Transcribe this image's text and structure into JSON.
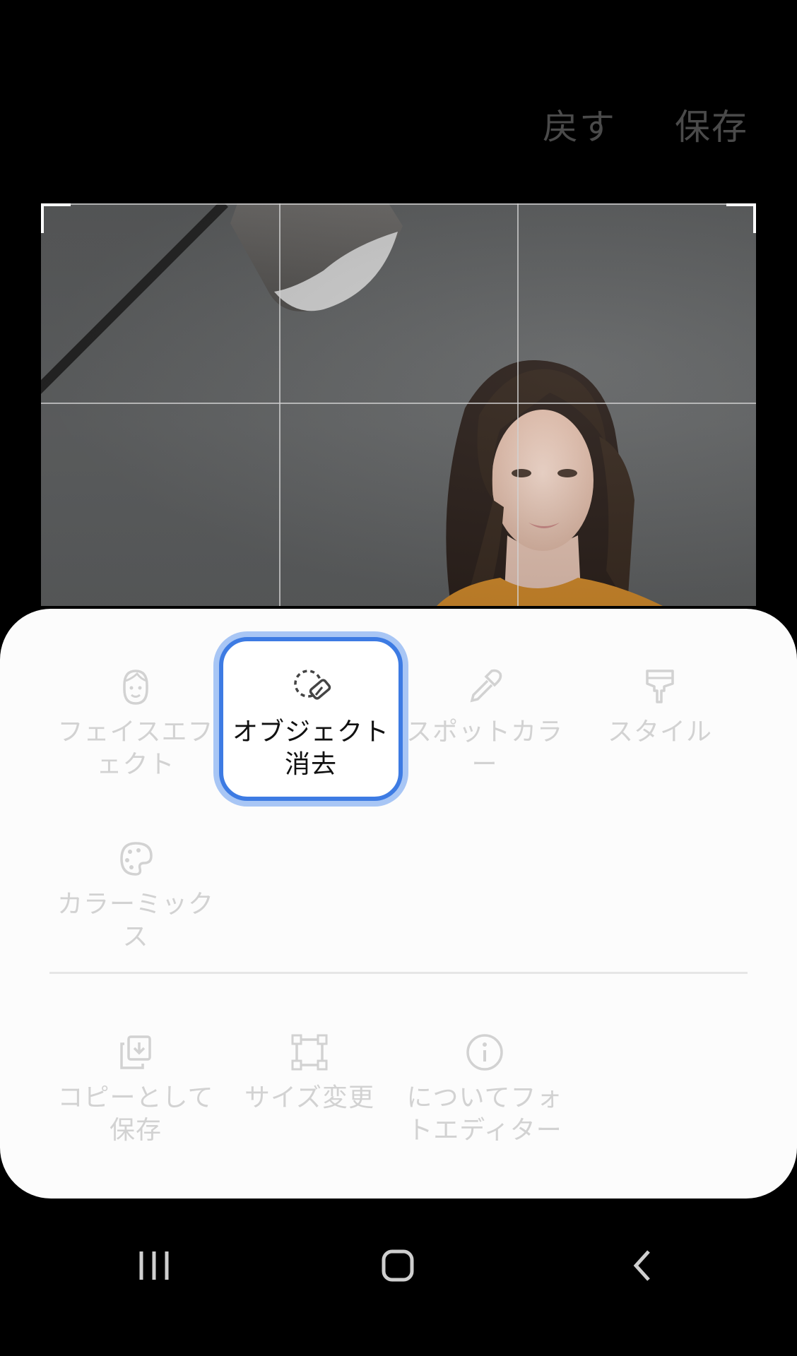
{
  "header": {
    "revert_label": "戻す",
    "save_label": "保存"
  },
  "menu": {
    "items": [
      {
        "label": "フェイスエフェクト",
        "icon": "face-icon"
      },
      {
        "label": "オブジェクト消去",
        "icon": "object-eraser-icon",
        "selected": true
      },
      {
        "label": "スポットカラー",
        "icon": "eyedropper-icon"
      },
      {
        "label": "スタイル",
        "icon": "paint-brush-icon"
      },
      {
        "label": "カラーミックス",
        "icon": "palette-icon"
      }
    ],
    "secondary": [
      {
        "label": "コピーとして保存",
        "icon": "save-copy-icon"
      },
      {
        "label": "サイズ変更",
        "icon": "resize-icon"
      },
      {
        "label": "についてフォトエディター",
        "icon": "info-icon"
      }
    ]
  },
  "nav": {
    "recents_icon": "recents-icon",
    "home_icon": "home-icon",
    "back_icon": "back-icon"
  },
  "colors": {
    "selection_border": "#3d7be3",
    "selection_glow": "#a8c6f5",
    "sheet_background": "#fcfcfc",
    "disabled_text": "#d2d2d2"
  }
}
